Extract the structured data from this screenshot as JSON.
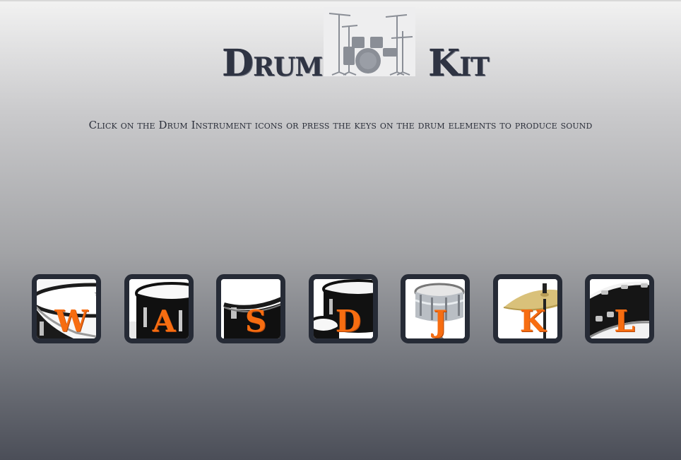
{
  "header": {
    "title_left": "Drum",
    "title_right": "Kit",
    "logo_icon": "drum-kit-icon"
  },
  "subtitle": "Click on the Drum Instrument icons or press the keys on the drum elements to produce sound",
  "accent_color": "#f76d11",
  "frame_color": "#262b36",
  "drums": [
    {
      "key": "W",
      "icon": "tom-drum-icon"
    },
    {
      "key": "A",
      "icon": "black-drum-icon"
    },
    {
      "key": "S",
      "icon": "drum-rim-icon"
    },
    {
      "key": "D",
      "icon": "tom-stack-icon"
    },
    {
      "key": "J",
      "icon": "snare-drum-icon"
    },
    {
      "key": "K",
      "icon": "cymbal-icon"
    },
    {
      "key": "L",
      "icon": "bass-drum-icon"
    }
  ]
}
